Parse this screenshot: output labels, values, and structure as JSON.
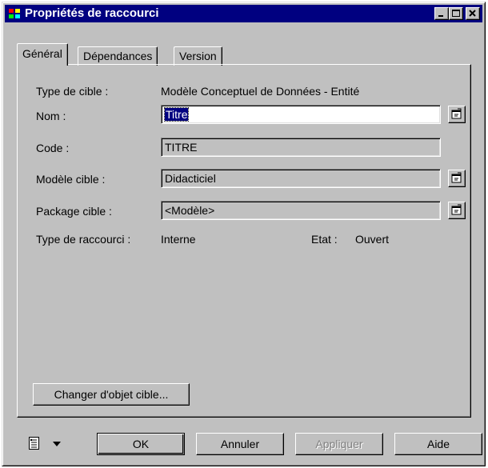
{
  "window": {
    "title": "Propriétés de raccourci"
  },
  "tabs": [
    {
      "label": "Général",
      "active": true
    },
    {
      "label": "Dépendances",
      "active": false
    },
    {
      "label": "Version",
      "active": false
    }
  ],
  "general": {
    "type_cible_label": "Type de cible :",
    "type_cible_value": "Modèle Conceptuel de Données - Entité",
    "nom_label": "Nom :",
    "nom_value": "Titre",
    "code_label": "Code :",
    "code_value": "TITRE",
    "modele_label": "Modèle cible :",
    "modele_value": "Didacticiel",
    "package_label": "Package cible :",
    "package_value": "<Modèle>",
    "type_raccourci_label": "Type de raccourci :",
    "type_raccourci_value": "Interne",
    "etat_label": "Etat :",
    "etat_value": "Ouvert",
    "changer_button": "Changer d'objet cible..."
  },
  "footer": {
    "ok": "OK",
    "annuler": "Annuler",
    "appliquer": "Appliquer",
    "aide": "Aide"
  },
  "icons": [
    "app-icon",
    "minimize-icon",
    "maximize-icon",
    "close-icon",
    "properties-icon",
    "menu-list-icon",
    "dropdown-arrow-icon"
  ]
}
